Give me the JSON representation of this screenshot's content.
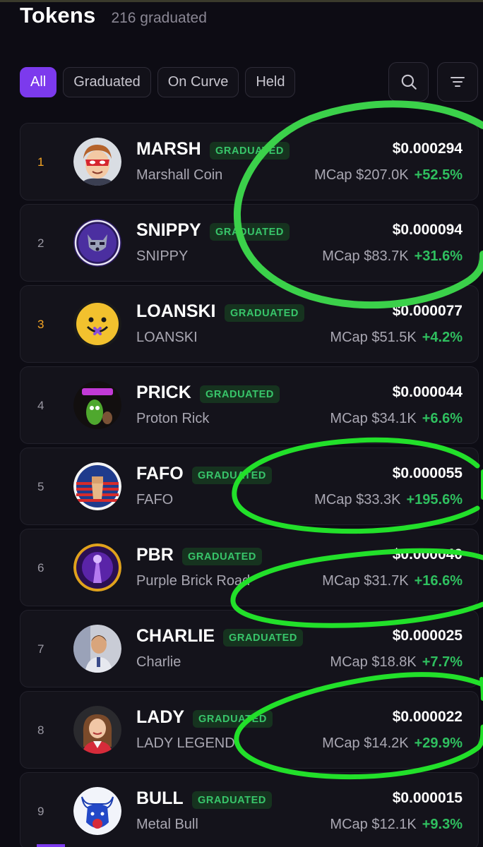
{
  "header": {
    "title": "Tokens",
    "subtitle": "216 graduated"
  },
  "filters": [
    {
      "label": "All",
      "active": true
    },
    {
      "label": "Graduated",
      "active": false
    },
    {
      "label": "On Curve",
      "active": false
    },
    {
      "label": "Held",
      "active": false
    }
  ],
  "icons": {
    "search": "search-icon",
    "filter": "filter-lines-icon"
  },
  "badge_label": "GRADUATED",
  "mcap_prefix": "MCap",
  "colors": {
    "accent": "#7c3aed",
    "badge_text": "#38c56a",
    "positive": "#2fbf5f",
    "rank_highlight": "#f5a524",
    "annotation": "#22e02a"
  },
  "tokens": [
    {
      "rank": "1",
      "symbol": "MARSH",
      "name": "Marshall Coin",
      "price": "$0.000294",
      "mcap": "$207.0K",
      "change": "+52.5%",
      "avatar": "masked-hero-avatar"
    },
    {
      "rank": "2",
      "symbol": "SNIPPY",
      "name": "SNIPPY",
      "price": "$0.000094",
      "mcap": "$83.7K",
      "change": "+31.6%",
      "avatar": "raccoon-avatar"
    },
    {
      "rank": "3",
      "symbol": "LOANSKI",
      "name": "LOANSKI",
      "price": "$0.000077",
      "mcap": "$51.5K",
      "change": "+4.2%",
      "avatar": "smiley-coin-avatar"
    },
    {
      "rank": "4",
      "symbol": "PRICK",
      "name": "Proton Rick",
      "price": "$0.000044",
      "mcap": "$34.1K",
      "change": "+6.6%",
      "avatar": "pickle-avatar"
    },
    {
      "rank": "5",
      "symbol": "FAFO",
      "name": "FAFO",
      "price": "$0.000055",
      "mcap": "$33.3K",
      "change": "+195.6%",
      "avatar": "flag-fist-avatar"
    },
    {
      "rank": "6",
      "symbol": "PBR",
      "name": "Purple Brick Road",
      "price": "$0.000040",
      "mcap": "$31.7K",
      "change": "+16.6%",
      "avatar": "purple-road-avatar"
    },
    {
      "rank": "7",
      "symbol": "CHARLIE",
      "name": "Charlie",
      "price": "$0.000025",
      "mcap": "$18.8K",
      "change": "+7.7%",
      "avatar": "photo-avatar"
    },
    {
      "rank": "8",
      "symbol": "LADY",
      "name": "LADY LEGEND",
      "price": "$0.000022",
      "mcap": "$14.2K",
      "change": "+29.9%",
      "avatar": "lady-avatar"
    },
    {
      "rank": "9",
      "symbol": "BULL",
      "name": "Metal Bull",
      "price": "$0.000015",
      "mcap": "$12.1K",
      "change": "+9.3%",
      "avatar": "blue-bull-avatar"
    }
  ]
}
